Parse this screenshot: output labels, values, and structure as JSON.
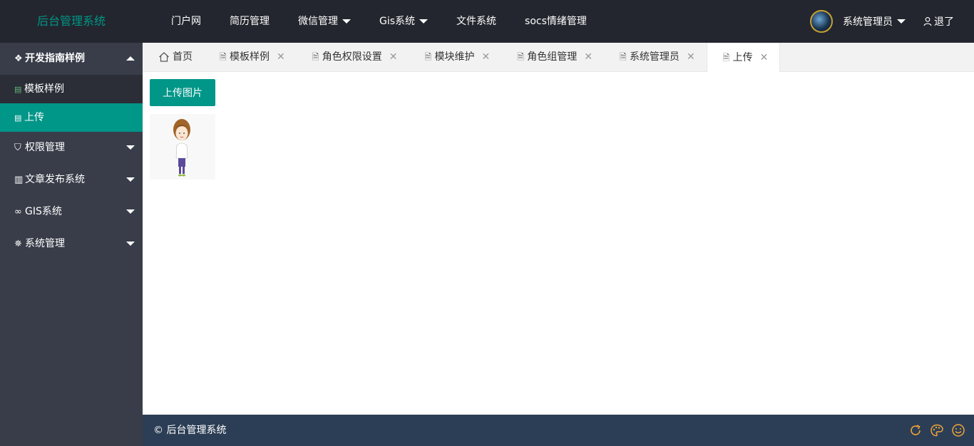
{
  "header": {
    "logo": "后台管理系统",
    "nav": [
      {
        "label": "门户网",
        "dropdown": false
      },
      {
        "label": "简历管理",
        "dropdown": false
      },
      {
        "label": "微信管理",
        "dropdown": true
      },
      {
        "label": "Gis系统",
        "dropdown": true
      },
      {
        "label": "文件系统",
        "dropdown": false
      },
      {
        "label": "socs情绪管理",
        "dropdown": false
      }
    ],
    "user_name": "系统管理员",
    "logout": "退了"
  },
  "sidebar": {
    "groups": [
      {
        "label": "开发指南样例",
        "icon": "layers-icon",
        "open": true,
        "items": [
          {
            "label": "模板样例",
            "active": false
          },
          {
            "label": "上传",
            "active": true
          }
        ]
      },
      {
        "label": "权限管理",
        "icon": "shield-icon",
        "open": false
      },
      {
        "label": "文章发布系统",
        "icon": "book-icon",
        "open": false
      },
      {
        "label": "GIS系统",
        "icon": "infinity-icon",
        "open": false
      },
      {
        "label": "系统管理",
        "icon": "gear-icon",
        "open": false
      }
    ]
  },
  "tabs": [
    {
      "label": "首页",
      "icon": "home-icon",
      "closable": false,
      "active": false
    },
    {
      "label": "模板样例",
      "icon": "file-icon",
      "closable": true,
      "active": false
    },
    {
      "label": "角色权限设置",
      "icon": "file-icon",
      "closable": true,
      "active": false
    },
    {
      "label": "模块维护",
      "icon": "file-icon",
      "closable": true,
      "active": false
    },
    {
      "label": "角色组管理",
      "icon": "file-icon",
      "closable": true,
      "active": false
    },
    {
      "label": "系统管理员",
      "icon": "file-icon",
      "closable": true,
      "active": false
    },
    {
      "label": "上传",
      "icon": "file-icon",
      "closable": true,
      "active": true
    }
  ],
  "content": {
    "upload_button": "上传图片"
  },
  "footer": {
    "text": "© 后台管理系统"
  },
  "colors": {
    "primary": "#009688",
    "header_bg": "#23262e",
    "sidebar_bg": "#393d49",
    "footer_bg": "#2c3e55",
    "footer_icon": "#f0a53a"
  }
}
